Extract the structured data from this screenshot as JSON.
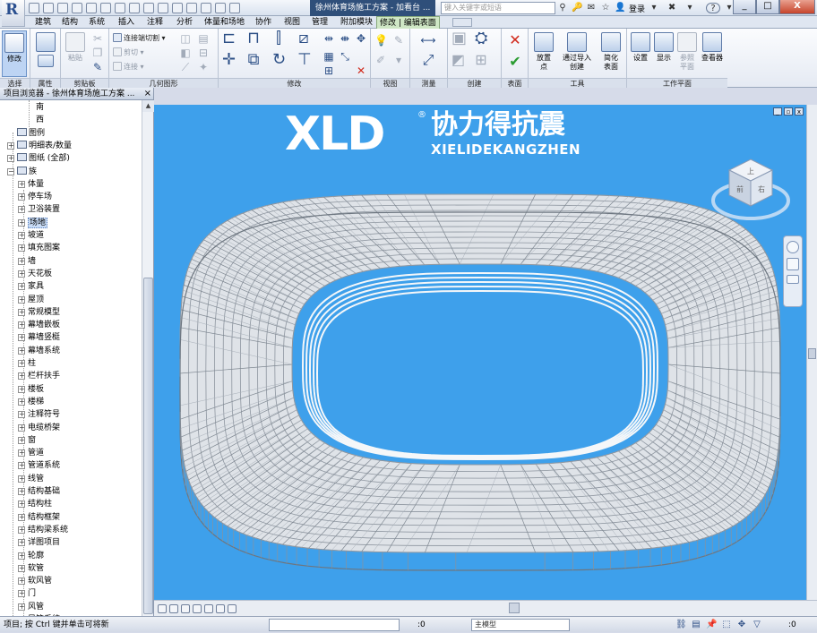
{
  "window": {
    "doc_title": "徐州体育场施工方案 - 加看台 ...",
    "search_placeholder": "键入关键字或短语",
    "login_label": "登录",
    "help_label": "?",
    "minimize": "_",
    "maximize": "□",
    "close": "X"
  },
  "tabs": [
    {
      "label": "建筑"
    },
    {
      "label": "结构"
    },
    {
      "label": "系统"
    },
    {
      "label": "插入"
    },
    {
      "label": "注释"
    },
    {
      "label": "分析"
    },
    {
      "label": "体量和场地"
    },
    {
      "label": "协作"
    },
    {
      "label": "视图"
    },
    {
      "label": "管理"
    },
    {
      "label": "附加模块"
    },
    {
      "label": "修改 | 编辑表面"
    }
  ],
  "ribbon": {
    "modify_label": "修改",
    "small_buttons": {
      "connect_cut": "连接端切割",
      "paste": "粘贴",
      "cut": "剪切",
      "join": "连接"
    },
    "panels": {
      "select": "选择",
      "properties": "属性",
      "clipboard": "剪贴板",
      "geometry": "几何图形",
      "modify": "修改",
      "view": "视图",
      "measure": "测量",
      "create": "创建",
      "surface": "表面",
      "tools": "工具",
      "workplane": "工作平面"
    },
    "tools_buttons": {
      "place_point": "放置\n点",
      "import_create": "通过导入\n创建",
      "simplify_surface": "简化\n表面"
    },
    "workplane_buttons": {
      "set": "设置",
      "show": "显示",
      "ref_plane": "参照\n平面",
      "viewer": "查看器"
    }
  },
  "browser": {
    "title": "项目浏览器 - 徐州体育场施工方案 ...",
    "close": "×",
    "items": [
      {
        "label": "南",
        "level": 3,
        "type": "leaf"
      },
      {
        "label": "西",
        "level": 3,
        "type": "leaf"
      },
      {
        "label": "图例",
        "level": 0,
        "type": "folder-empty"
      },
      {
        "label": "明细表/数量",
        "level": 0,
        "type": "folder"
      },
      {
        "label": "图纸 (全部)",
        "level": 0,
        "type": "folder"
      },
      {
        "label": "族",
        "level": 0,
        "type": "folder-open"
      },
      {
        "label": "体量",
        "level": 1,
        "type": "node"
      },
      {
        "label": "停车场",
        "level": 1,
        "type": "node"
      },
      {
        "label": "卫浴装置",
        "level": 1,
        "type": "node"
      },
      {
        "label": "场地",
        "level": 1,
        "type": "node",
        "selected": true
      },
      {
        "label": "坡道",
        "level": 1,
        "type": "node"
      },
      {
        "label": "填充图案",
        "level": 1,
        "type": "node"
      },
      {
        "label": "墙",
        "level": 1,
        "type": "node"
      },
      {
        "label": "天花板",
        "level": 1,
        "type": "node"
      },
      {
        "label": "家具",
        "level": 1,
        "type": "node"
      },
      {
        "label": "屋顶",
        "level": 1,
        "type": "node"
      },
      {
        "label": "常规模型",
        "level": 1,
        "type": "node"
      },
      {
        "label": "幕墙嵌板",
        "level": 1,
        "type": "node"
      },
      {
        "label": "幕墙竖梃",
        "level": 1,
        "type": "node"
      },
      {
        "label": "幕墙系统",
        "level": 1,
        "type": "node"
      },
      {
        "label": "柱",
        "level": 1,
        "type": "node"
      },
      {
        "label": "栏杆扶手",
        "level": 1,
        "type": "node"
      },
      {
        "label": "楼板",
        "level": 1,
        "type": "node"
      },
      {
        "label": "楼梯",
        "level": 1,
        "type": "node"
      },
      {
        "label": "注释符号",
        "level": 1,
        "type": "node"
      },
      {
        "label": "电缆桥架",
        "level": 1,
        "type": "node"
      },
      {
        "label": "窗",
        "level": 1,
        "type": "node"
      },
      {
        "label": "管道",
        "level": 1,
        "type": "node"
      },
      {
        "label": "管道系统",
        "level": 1,
        "type": "node"
      },
      {
        "label": "线管",
        "level": 1,
        "type": "node"
      },
      {
        "label": "结构基础",
        "level": 1,
        "type": "node"
      },
      {
        "label": "结构柱",
        "level": 1,
        "type": "node"
      },
      {
        "label": "结构框架",
        "level": 1,
        "type": "node"
      },
      {
        "label": "结构梁系统",
        "level": 1,
        "type": "node"
      },
      {
        "label": "详图项目",
        "level": 1,
        "type": "node"
      },
      {
        "label": "轮廓",
        "level": 1,
        "type": "node"
      },
      {
        "label": "软管",
        "level": 1,
        "type": "node"
      },
      {
        "label": "软风管",
        "level": 1,
        "type": "node"
      },
      {
        "label": "门",
        "level": 1,
        "type": "node"
      },
      {
        "label": "风管",
        "level": 1,
        "type": "node"
      },
      {
        "label": "风管系统",
        "level": 1,
        "type": "node"
      }
    ]
  },
  "viewport": {
    "logo_text": "XLD",
    "logo_reg": "®",
    "logo_cn": "协力得抗震",
    "logo_en": "XIELIDEKANGZHEN",
    "viewcube_top": "上",
    "viewcube_front": "前",
    "viewcube_right": "右"
  },
  "status": {
    "text": "项目; 按 Ctrl 键并单击可将新",
    "count_1": ":0",
    "model_field": "主模型",
    "count_2": ":0"
  },
  "colors": {
    "viewport_bg": "#3ea0eb",
    "contextual_tab": "#cfe7c5"
  }
}
